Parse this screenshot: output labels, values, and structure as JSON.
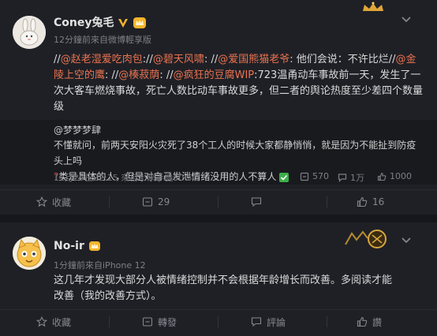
{
  "post1": {
    "username": "Coney兔毛",
    "meta": "12分鐘前來自微博輕享版",
    "text_prefix": "//",
    "mention1": "@赵老湿爱吃肉包",
    "sep1": "://",
    "mention2": "@碧天风啸",
    "sep2": ": //",
    "mention3": "@爱国熊猫老爷",
    "after3": ": 他们会说：不许比烂//",
    "mention4": "@金陵上空的鹰",
    "sep4": ": //",
    "mention5": "@楱菽荫",
    "sep5": ": //",
    "mention6": "@疯狂的豆腐WIP",
    "rest": ":723温甬动车事故前一天，发生了一次大客车燃烧事故，死亡人数比动车事故更多，但二者的舆论热度至少差四个数量级",
    "repost": {
      "author": "@梦梦梦肆",
      "text_line1": "不懂就问，前两天安阳火灾死了38个工人的时候大家都静悄悄，就是因为不能扯到防疫头上吗",
      "text_line2": "类是具体的人，但是对自己发泄情绪没用的人不算人",
      "meta": "11月25日22:15  來自小米手機60 5G",
      "reposts": "570",
      "comments": "1万",
      "likes": "1000"
    },
    "actions": {
      "favorite": "收藏",
      "repost": "29",
      "comment": "",
      "like": "16"
    }
  },
  "post2": {
    "username": "No-ir",
    "meta": "1分鐘前來自iPhone 12",
    "text": "这几年才发现大部分人被情绪控制并不会根据年龄增长而改善。多阅读才能改善（我的改善方式）。",
    "actions": {
      "favorite": "收藏",
      "repost": "轉發",
      "comment": "評論",
      "like": "讚"
    }
  },
  "colors": {
    "link": "#eb7350",
    "vip_gold": "#f5b52b",
    "background": "#1f2026"
  }
}
